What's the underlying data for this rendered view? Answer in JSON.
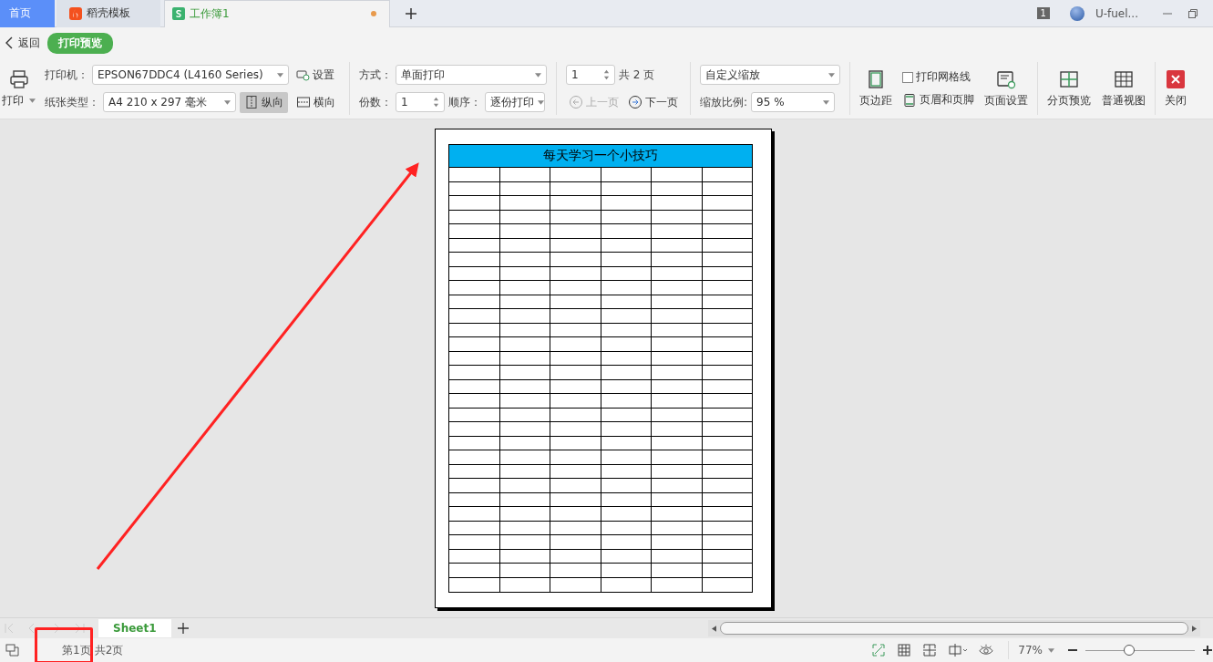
{
  "tabs": [
    {
      "label": "首页",
      "selected": false,
      "kind": "home"
    },
    {
      "label": "稻壳模板",
      "selected": false,
      "kind": "docer"
    },
    {
      "label": "工作簿1",
      "selected": true,
      "kind": "sheet",
      "unsaved": true
    }
  ],
  "account": {
    "badge": "1",
    "name": "U-fuel..."
  },
  "nav": {
    "back": "返回",
    "mode": "打印预览"
  },
  "ribbon": {
    "print": "打印",
    "printer": {
      "label": "打印机：",
      "value": "EPSON67DDC4 (L4160 Series)"
    },
    "settings": "设置",
    "paper": {
      "label": "纸张类型：",
      "value": "A4 210 x 297 毫米"
    },
    "orientation": [
      {
        "label": "纵向",
        "selected": true,
        "kind": "portrait"
      },
      {
        "label": "横向",
        "selected": false,
        "kind": "landscape"
      }
    ],
    "mode": {
      "label": "方式：",
      "value": "单面打印"
    },
    "copies": {
      "label": "份数：",
      "value": "1"
    },
    "order": {
      "label": "顺序：",
      "value": "逐份打印"
    },
    "page": {
      "value": "1",
      "total": "共 2 页"
    },
    "prev": {
      "label": "上一页",
      "disabled": true
    },
    "next": {
      "label": "下一页",
      "disabled": false
    },
    "scale": {
      "value": "自定义缩放",
      "label": "缩放比例:",
      "ratio": "95 %"
    },
    "margins": "页边距",
    "gridlines": {
      "label": "打印网格线",
      "checked": false
    },
    "header_footer": "页眉和页脚",
    "page_setup": "页面设置",
    "page_break": "分页预览",
    "normal_view": "普通视图",
    "close": "关闭"
  },
  "page_preview": {
    "title": "每天学习一个小技巧"
  },
  "sheet_tabs": [
    {
      "label": "Sheet1",
      "selected": true
    }
  ],
  "status_bar": {
    "page": "第1页",
    "total": "共2页",
    "zoom": "77%",
    "zoom_slider": {
      "level": 0.4
    }
  }
}
